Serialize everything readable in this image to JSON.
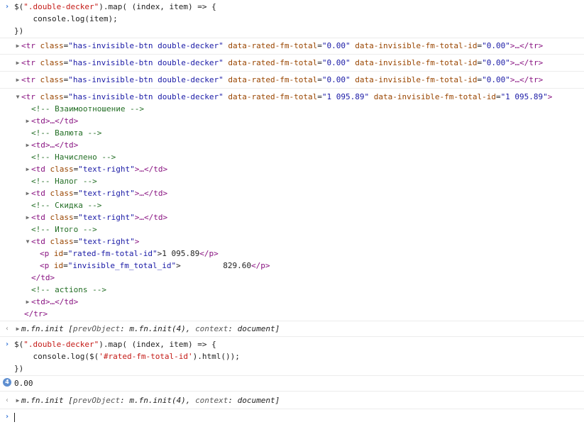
{
  "prompt_glyph": "›",
  "result_glyph": "‹",
  "cmd1": {
    "line1_pre": "$(",
    "line1_str": "\".double-decker\"",
    "line1_post": ").map( (index, item) => {",
    "line2": "    console.log(item);",
    "line3": "})"
  },
  "rows": {
    "tag_open": "<tr",
    "class_attr": "class",
    "class_val": "\"has-invisible-btn double-decker\"",
    "rated_attr": "data-rated-fm-total",
    "rated_val_zero": "\"0.00\"",
    "invis_attr": "data-invisible-fm-total-id",
    "invis_val_zero": "\"0.00\"",
    "collapsed_end": ">…</tr>",
    "rated_val_4": "\"1 095.89\"",
    "invis_val_4": "\"1 095.89\"",
    "open_end": ">"
  },
  "expanded": {
    "c1": "<!-- Взаимоотношение -->",
    "td_collapsed": "<td>…</td>",
    "c2": "<!-- Валюта -->",
    "c3": "<!-- Начислено -->",
    "td_tag": "<td",
    "td_class_attr": "class",
    "td_class_val": "\"text-right\"",
    "td_collapsed_end": ">…</td>",
    "c4": "<!-- Налог -->",
    "c5": "<!-- Скидка -->",
    "c6": "<!-- Итого -->",
    "td_open_end": ">",
    "p_tag": "<p",
    "id_attr": "id",
    "p1_id_val": "\"rated-fm-total-id\"",
    "p1_text": ">1 095.89",
    "p_close": "</p>",
    "p2_id_val": "\"invisible_fm_total_id\"",
    "p2_text": ">         829.60",
    "td_close": "</td>",
    "c7": "<!-- actions -->",
    "tr_close": "</tr>"
  },
  "result1": {
    "name": "m.fn.init",
    "pre": " [",
    "key1": "prevObject",
    "v1": ": m.fn.init(4), ",
    "key2": "context",
    "v2": ": document]"
  },
  "cmd2": {
    "line1_pre": "$(",
    "line1_str": "\".double-decker\"",
    "line1_post": ").map( (index, item) => {",
    "line2_pre": "    console.log($(",
    "line2_str": "'#rated-fm-total-id'",
    "line2_post": ").html());",
    "line3": "})"
  },
  "log_output": {
    "count": "4",
    "text": "0.00"
  },
  "result2": {
    "name": "m.fn.init",
    "pre": " [",
    "key1": "prevObject",
    "v1": ": m.fn.init(4), ",
    "key2": "context",
    "v2": ": document]"
  },
  "colors": {
    "tag": "#881280",
    "attr": "#994500",
    "value": "#1a1aa6",
    "comment": "#236e25",
    "prompt": "#2c6fd6",
    "badge": "#5f8fd0"
  }
}
